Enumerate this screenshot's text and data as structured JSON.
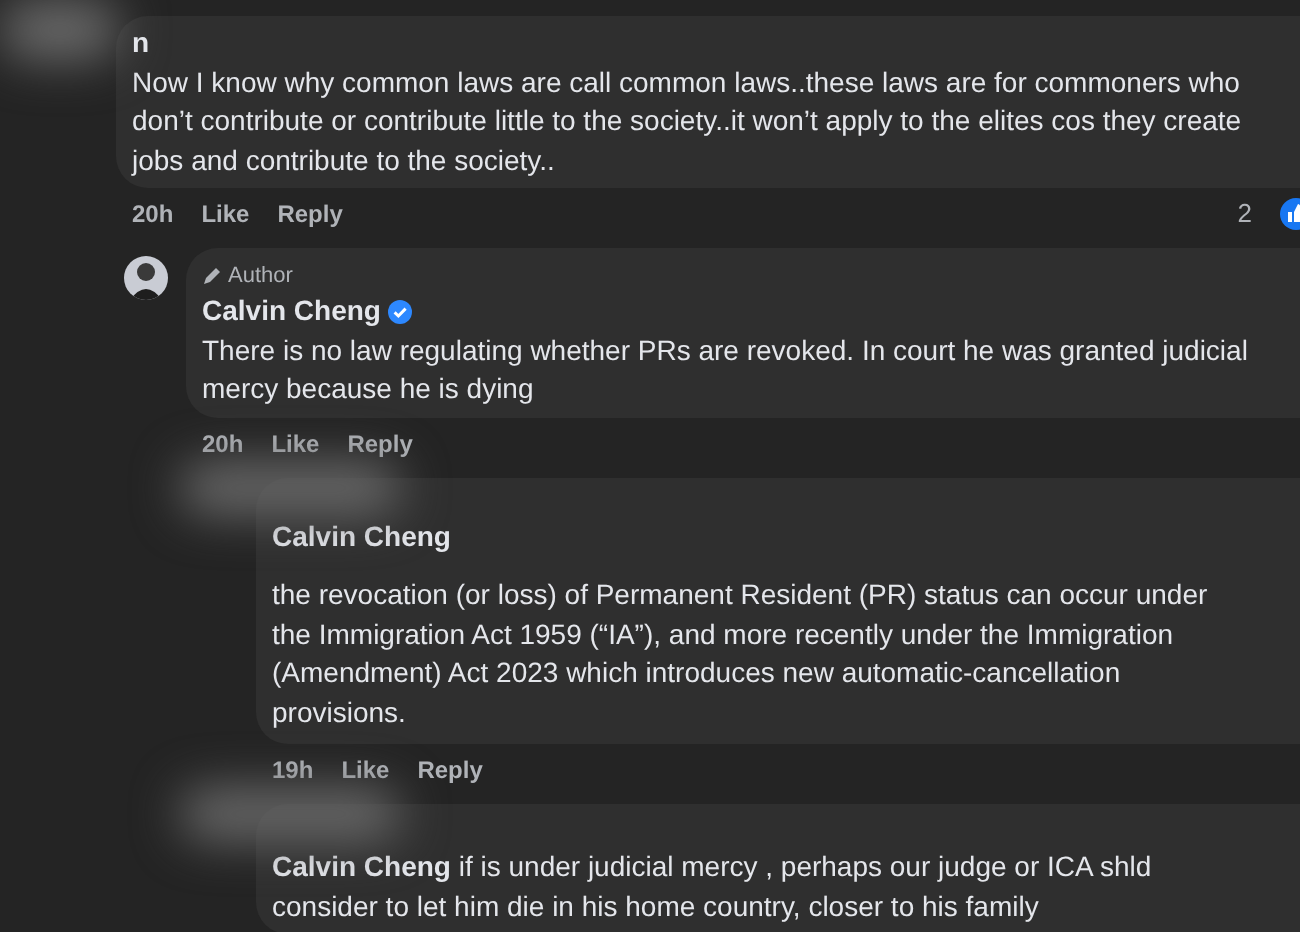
{
  "comments": [
    {
      "author": "n",
      "avatar_blurred": true,
      "paragraphs": [
        "Now I know why common laws are call common laws..these laws are for commoners who don’t contribute or contribute little to the society..it won’t apply to the elites cos they create jobs and contribute to the society.."
      ],
      "time": "20h",
      "like": "Like",
      "reply": "Reply",
      "reaction_count": "2",
      "children": [
        {
          "badge": "Author",
          "author": "Calvin Cheng",
          "verified": true,
          "avatar_blurred": false,
          "paragraphs": [
            "There is no law regulating whether PRs are revoked. In court he was granted judicial mercy because he is dying"
          ],
          "time": "20h",
          "like": "Like",
          "reply": "Reply",
          "children": [
            {
              "avatar_blurred": true,
              "paragraphs": [
                "**Calvin Cheng**",
                "the revocation (or loss) of Permanent Resident (PR) status can occur under the Immigration Act 1959 (“IA”), and more recently under the Immigration (Amendment) Act 2023 which introduces new automatic-cancellation provisions."
              ],
              "time": "19h",
              "like": "Like",
              "reply": "Reply"
            },
            {
              "avatar_blurred": true,
              "paragraphs": [
                "**Calvin Cheng** if is under judicial mercy , perhaps our judge or ICA shld consider to let him die in his home country, closer to his family"
              ]
            }
          ]
        }
      ]
    }
  ]
}
